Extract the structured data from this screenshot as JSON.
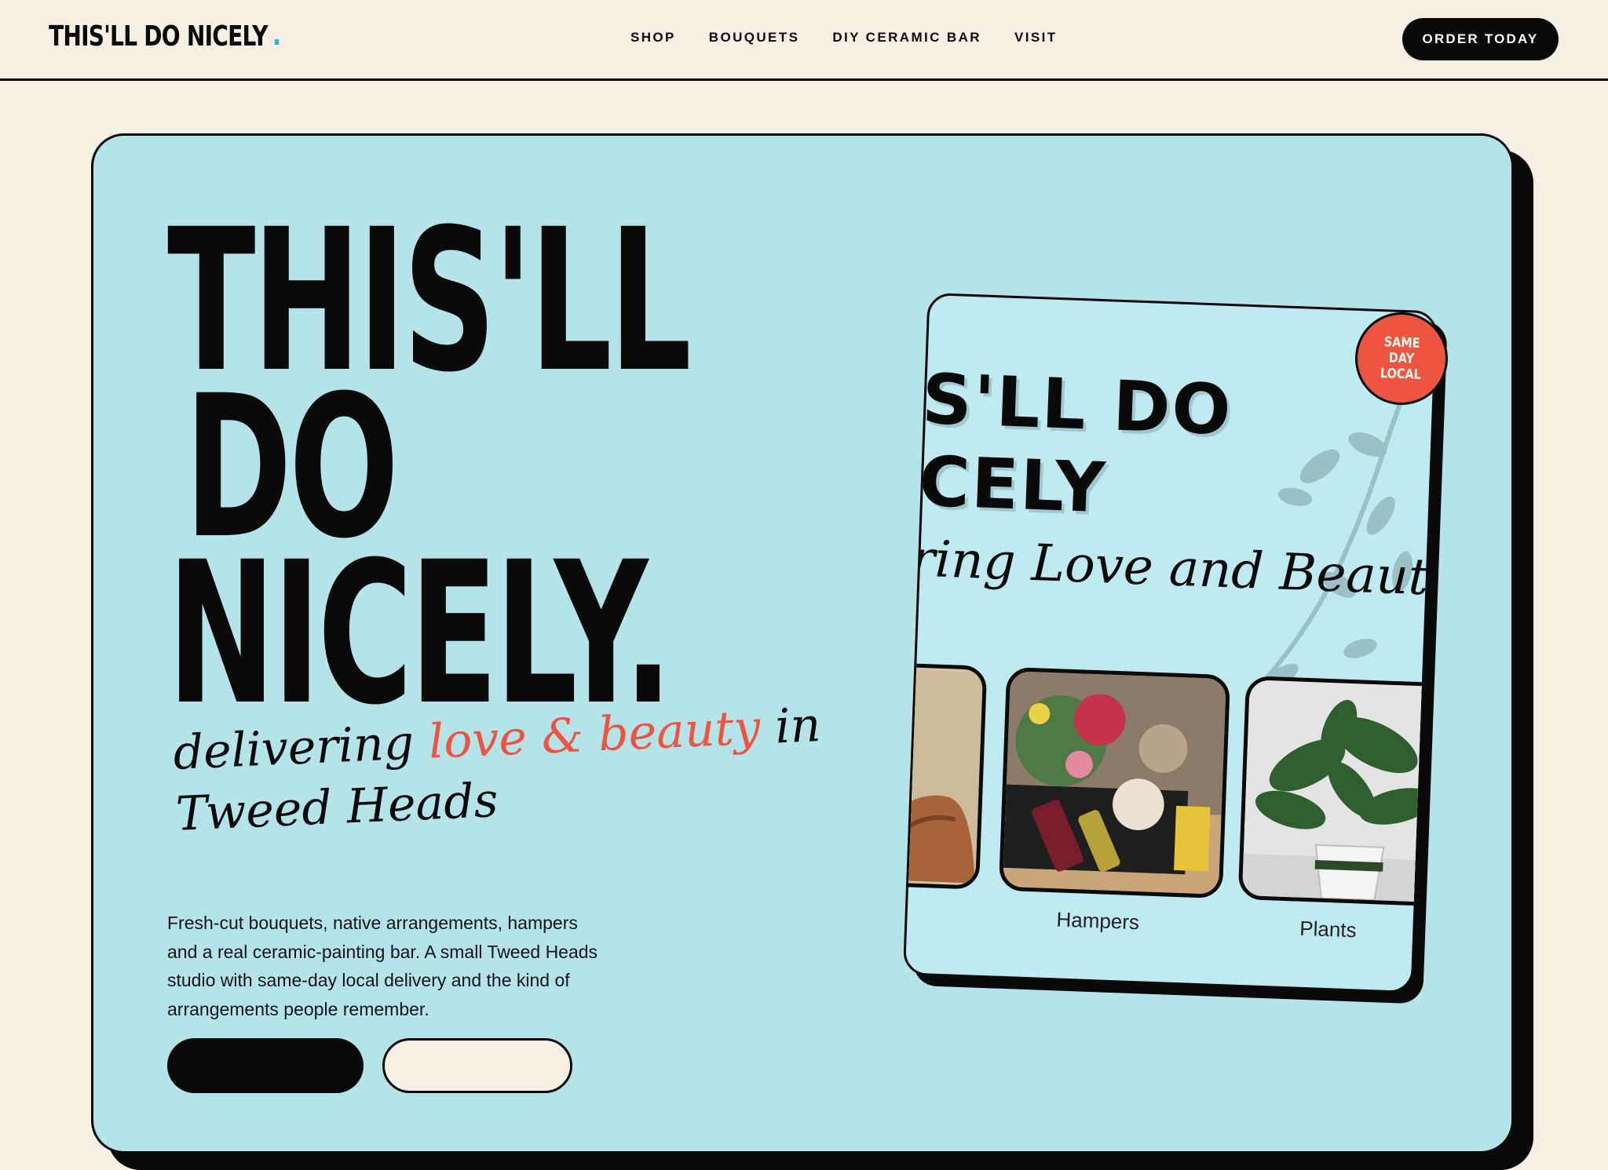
{
  "header": {
    "logo": "THIS'LL DO NICELY",
    "nav": [
      "SHOP",
      "BOUQUETS",
      "DIY CERAMIC BAR",
      "VISIT"
    ],
    "cta": "ORDER TODAY"
  },
  "hero": {
    "headline": [
      "THIS'LL",
      "DO",
      "NICELY."
    ],
    "tagline_parts": [
      "delivering ",
      "love & beauty",
      " in Tweed Heads"
    ],
    "description": "Fresh-cut bouquets, native arrangements, hampers and a real ceramic-painting bar. A small Tweed Heads studio with same-day local delivery and the kind of arrangements people remember."
  },
  "card": {
    "title_lines": [
      "IS'LL DO",
      "ICELY"
    ],
    "script": "ring Love and Beauty",
    "badge_lines": [
      "SAME",
      "DAY",
      "LOCAL"
    ],
    "tiles": [
      {
        "label": ""
      },
      {
        "label": "Hampers"
      },
      {
        "label": "Plants"
      }
    ]
  },
  "colors": {
    "background": "#f6efe4",
    "hero": "#b4e3e9",
    "accent": "#ee5540",
    "ink": "#0a0a0a"
  }
}
